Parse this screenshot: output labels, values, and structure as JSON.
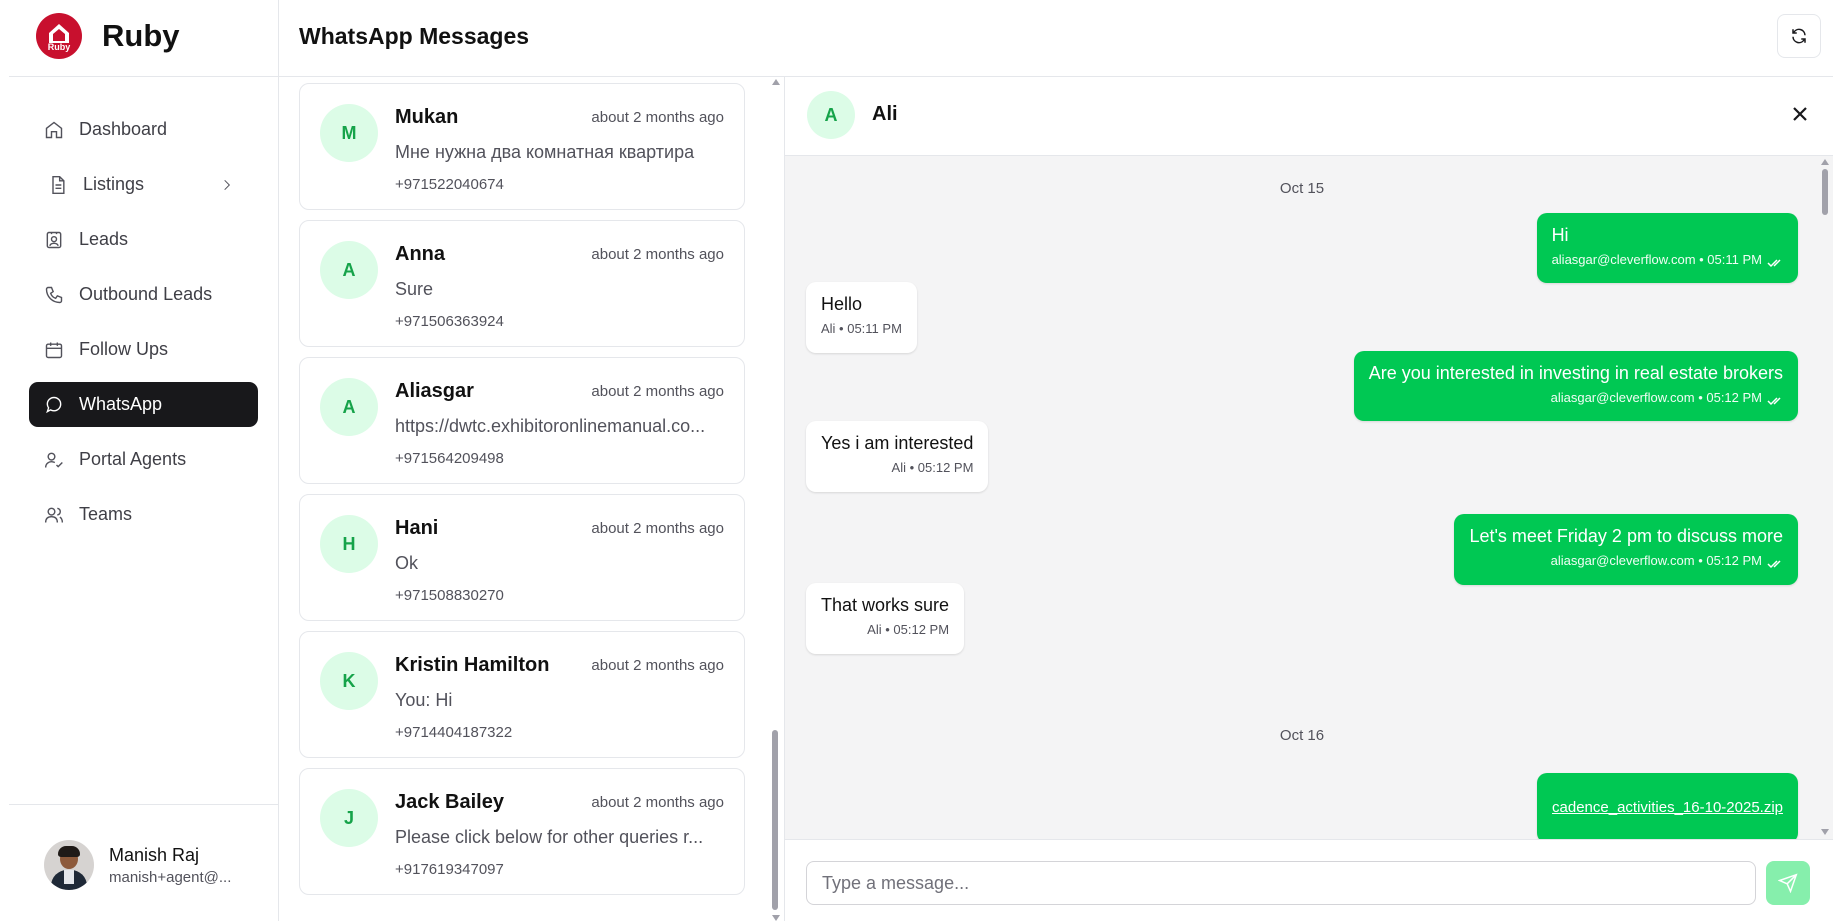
{
  "brand": {
    "name": "Ruby",
    "logo_text": "Ruby"
  },
  "sidebar": {
    "items": [
      {
        "label": "Dashboard",
        "icon": "home-icon"
      },
      {
        "label": "Listings",
        "icon": "document-icon",
        "has_submenu": true
      },
      {
        "label": "Leads",
        "icon": "contact-card-icon"
      },
      {
        "label": "Outbound Leads",
        "icon": "phone-icon"
      },
      {
        "label": "Follow Ups",
        "icon": "calendar-icon"
      },
      {
        "label": "WhatsApp",
        "icon": "message-circle-icon",
        "active": true
      },
      {
        "label": "Portal Agents",
        "icon": "user-check-icon"
      },
      {
        "label": "Teams",
        "icon": "users-icon"
      }
    ]
  },
  "user": {
    "name": "Manish Raj",
    "email": "manish+agent@..."
  },
  "header": {
    "title": "WhatsApp Messages",
    "refresh_icon": "refresh-icon"
  },
  "conversations": [
    {
      "initial": "M",
      "name": "Mukan",
      "time": "about 2 months ago",
      "message": "Мне нужна два комнатная квартира",
      "phone": "+971522040674"
    },
    {
      "initial": "A",
      "name": "Anna",
      "time": "about 2 months ago",
      "message": "Sure",
      "phone": "+971506363924"
    },
    {
      "initial": "A",
      "name": "Aliasgar",
      "time": "about 2 months ago",
      "message": "https://dwtc.exhibitoronlinemanual.co...",
      "phone": "+971564209498"
    },
    {
      "initial": "H",
      "name": "Hani",
      "time": "about 2 months ago",
      "message": "Ok",
      "phone": "+971508830270"
    },
    {
      "initial": "K",
      "name": "Kristin Hamilton",
      "time": "about 2 months ago",
      "message": "You: Hi",
      "phone": "+9714404187322"
    },
    {
      "initial": "J",
      "name": "Jack Bailey",
      "time": "about 2 months ago",
      "message": "Please click below for other queries r...",
      "phone": "+917619347097"
    }
  ],
  "chat": {
    "initial": "A",
    "name": "Ali",
    "date_1": "Oct 15",
    "date_2": "Oct 16",
    "messages": [
      {
        "direction": "out",
        "text": "Hi",
        "meta": "aliasgar@cleverflow.com • 05:11 PM"
      },
      {
        "direction": "in",
        "text": "Hello",
        "meta": "Ali • 05:11 PM"
      },
      {
        "direction": "out",
        "text": "Are you interested in investing in real estate brokers",
        "meta": "aliasgar@cleverflow.com • 05:12 PM"
      },
      {
        "direction": "in",
        "text": "Yes i am interested",
        "meta": "Ali • 05:12 PM"
      },
      {
        "direction": "out",
        "text": "Let's meet Friday 2 pm to discuss more",
        "meta": "aliasgar@cleverflow.com • 05:12 PM"
      },
      {
        "direction": "in",
        "text": "That works sure",
        "meta": "Ali • 05:12 PM"
      },
      {
        "direction": "out",
        "text": "cadence_activities_16-10-2025.zip",
        "attachment": true
      }
    ],
    "input_placeholder": "Type a message...",
    "input_value": ""
  },
  "colors": {
    "accent": "#00c853",
    "avatar_bg": "#dcfce7",
    "avatar_fg": "#16a34a",
    "active_nav": "#18181b",
    "send_btn": "#86efac"
  }
}
